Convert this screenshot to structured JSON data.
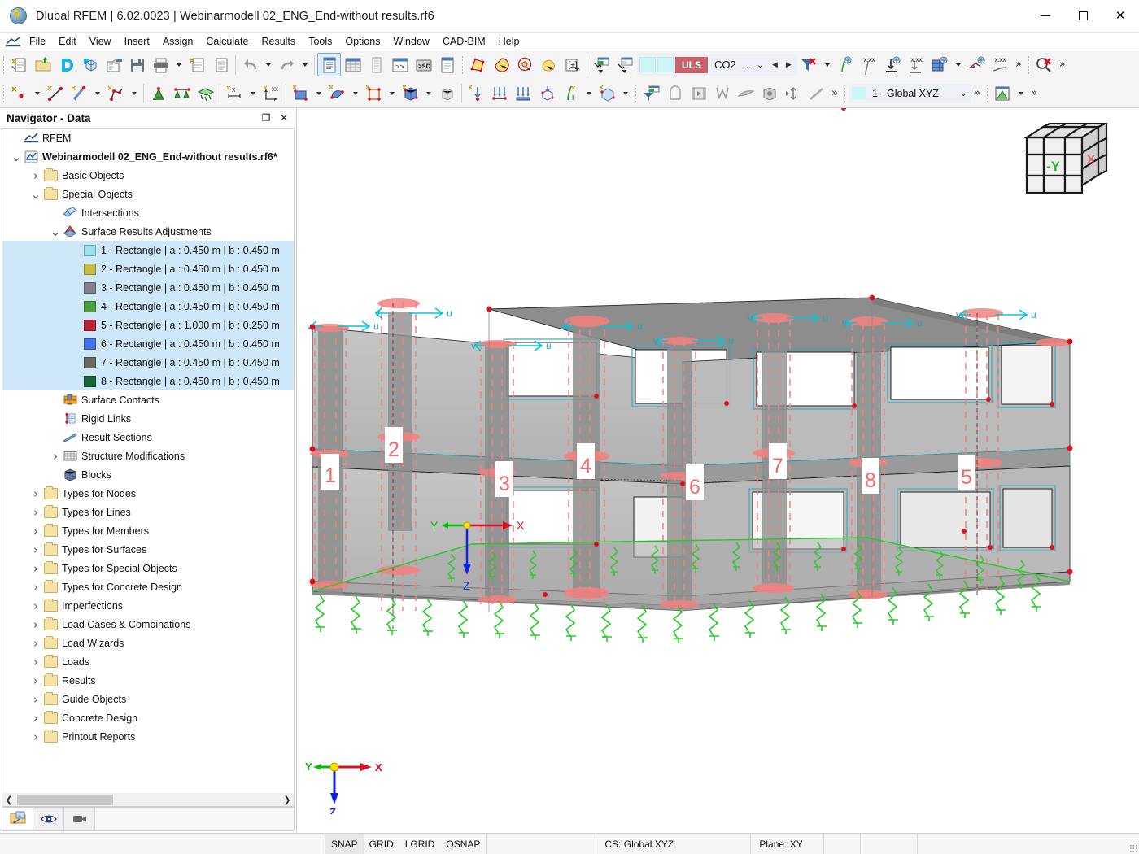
{
  "window": {
    "title": "Dlubal RFEM | 6.02.0023 | Webinarmodell 02_ENG_End-without results.rf6",
    "app_icon": "dlubal-globe-icon",
    "minimize_label": "Minimize",
    "maximize_label": "Maximize",
    "close_label": "Close"
  },
  "menubar": {
    "items": [
      {
        "label": "File"
      },
      {
        "label": "Edit"
      },
      {
        "label": "View"
      },
      {
        "label": "Insert"
      },
      {
        "label": "Assign"
      },
      {
        "label": "Calculate"
      },
      {
        "label": "Results"
      },
      {
        "label": "Tools"
      },
      {
        "label": "Options"
      },
      {
        "label": "Window"
      },
      {
        "label": "CAD-BIM"
      },
      {
        "label": "Help"
      }
    ]
  },
  "toolbar_loadcase": {
    "uls_label": "ULS",
    "co2_label": "CO2",
    "ellipsis_label": "...",
    "prev_label": "◀",
    "next_label": "▶"
  },
  "toolbar_cs": {
    "value": "1 - Global XYZ",
    "overflow_label": "»"
  },
  "navigator": {
    "title": "Navigator - Data",
    "undock_label": "❐",
    "close_label": "✕",
    "tabs": [
      {
        "name": "data-tab",
        "icon": "navigator-data-icon",
        "active": true
      },
      {
        "name": "display-tab",
        "icon": "eye-icon",
        "active": false
      },
      {
        "name": "views-tab",
        "icon": "video-camera-icon",
        "active": false
      }
    ],
    "tree": [
      {
        "label": "RFEM",
        "indent": 0,
        "icon": "rfem-icon",
        "twisty": "",
        "bold": false,
        "selected": false
      },
      {
        "label": "Webinarmodell 02_ENG_End-without results.rf6*",
        "indent": 0,
        "icon": "model-icon",
        "twisty": "expanded",
        "bold": true,
        "selected": false
      },
      {
        "label": "Basic Objects",
        "indent": 1,
        "icon": "folder",
        "twisty": "collapsed",
        "bold": false,
        "selected": false
      },
      {
        "label": "Special Objects",
        "indent": 1,
        "icon": "folder",
        "twisty": "expanded",
        "bold": false,
        "selected": false
      },
      {
        "label": "Intersections",
        "indent": 2,
        "icon": "intersections-icon",
        "twisty": "",
        "bold": false,
        "selected": false
      },
      {
        "label": "Surface Results Adjustments",
        "indent": 2,
        "icon": "surface-results-adjustments-icon",
        "twisty": "expanded",
        "bold": false,
        "selected": false
      },
      {
        "label": "1 - Rectangle | a : 0.450 m | b : 0.450 m",
        "indent": 3,
        "icon": "color-swatch",
        "color": "#9fe2ee",
        "twisty": "",
        "bold": false,
        "selected": true
      },
      {
        "label": "2 - Rectangle | a : 0.450 m | b : 0.450 m",
        "indent": 3,
        "icon": "color-swatch",
        "color": "#c4bd45",
        "twisty": "",
        "bold": false,
        "selected": true
      },
      {
        "label": "3 - Rectangle | a : 0.450 m | b : 0.450 m",
        "indent": 3,
        "icon": "color-swatch",
        "color": "#837f92",
        "twisty": "",
        "bold": false,
        "selected": true
      },
      {
        "label": "4 - Rectangle | a : 0.450 m | b : 0.450 m",
        "indent": 3,
        "icon": "color-swatch",
        "color": "#4a9e3c",
        "twisty": "",
        "bold": false,
        "selected": true
      },
      {
        "label": "5 - Rectangle | a : 1.000 m | b : 0.250 m",
        "indent": 3,
        "icon": "color-swatch",
        "color": "#bb2137",
        "twisty": "",
        "bold": false,
        "selected": true
      },
      {
        "label": "6 - Rectangle | a : 0.450 m | b : 0.450 m",
        "indent": 3,
        "icon": "color-swatch",
        "color": "#4a72e8",
        "twisty": "",
        "bold": false,
        "selected": true
      },
      {
        "label": "7 - Rectangle | a : 0.450 m | b : 0.450 m",
        "indent": 3,
        "icon": "color-swatch",
        "color": "#676a60",
        "twisty": "",
        "bold": false,
        "selected": true
      },
      {
        "label": "8 - Rectangle | a : 0.450 m | b : 0.450 m",
        "indent": 3,
        "icon": "color-swatch",
        "color": "#18663a",
        "twisty": "",
        "bold": false,
        "selected": true
      },
      {
        "label": "Surface Contacts",
        "indent": 2,
        "icon": "surface-contacts-icon",
        "twisty": "",
        "bold": false,
        "selected": false
      },
      {
        "label": "Rigid Links",
        "indent": 2,
        "icon": "rigid-links-icon",
        "twisty": "",
        "bold": false,
        "selected": false
      },
      {
        "label": "Result Sections",
        "indent": 2,
        "icon": "result-sections-icon",
        "twisty": "",
        "bold": false,
        "selected": false
      },
      {
        "label": "Structure Modifications",
        "indent": 2,
        "icon": "structure-modifications-icon",
        "twisty": "collapsed",
        "bold": false,
        "selected": false
      },
      {
        "label": "Blocks",
        "indent": 2,
        "icon": "blocks-icon",
        "twisty": "",
        "bold": false,
        "selected": false
      },
      {
        "label": "Types for Nodes",
        "indent": 1,
        "icon": "folder",
        "twisty": "collapsed",
        "bold": false,
        "selected": false
      },
      {
        "label": "Types for Lines",
        "indent": 1,
        "icon": "folder",
        "twisty": "collapsed",
        "bold": false,
        "selected": false
      },
      {
        "label": "Types for Members",
        "indent": 1,
        "icon": "folder",
        "twisty": "collapsed",
        "bold": false,
        "selected": false
      },
      {
        "label": "Types for Surfaces",
        "indent": 1,
        "icon": "folder",
        "twisty": "collapsed",
        "bold": false,
        "selected": false
      },
      {
        "label": "Types for Special Objects",
        "indent": 1,
        "icon": "folder",
        "twisty": "collapsed",
        "bold": false,
        "selected": false
      },
      {
        "label": "Types for Concrete Design",
        "indent": 1,
        "icon": "folder",
        "twisty": "collapsed",
        "bold": false,
        "selected": false
      },
      {
        "label": "Imperfections",
        "indent": 1,
        "icon": "folder",
        "twisty": "collapsed",
        "bold": false,
        "selected": false
      },
      {
        "label": "Load Cases & Combinations",
        "indent": 1,
        "icon": "folder",
        "twisty": "collapsed",
        "bold": false,
        "selected": false
      },
      {
        "label": "Load Wizards",
        "indent": 1,
        "icon": "folder",
        "twisty": "collapsed",
        "bold": false,
        "selected": false
      },
      {
        "label": "Loads",
        "indent": 1,
        "icon": "folder",
        "twisty": "collapsed",
        "bold": false,
        "selected": false
      },
      {
        "label": "Results",
        "indent": 1,
        "icon": "folder",
        "twisty": "collapsed",
        "bold": false,
        "selected": false
      },
      {
        "label": "Guide Objects",
        "indent": 1,
        "icon": "folder",
        "twisty": "collapsed",
        "bold": false,
        "selected": false
      },
      {
        "label": "Concrete Design",
        "indent": 1,
        "icon": "folder",
        "twisty": "collapsed",
        "bold": false,
        "selected": false
      },
      {
        "label": "Printout Reports",
        "indent": 1,
        "icon": "folder",
        "twisty": "collapsed",
        "bold": false,
        "selected": false
      }
    ]
  },
  "viewport": {
    "viewcube": {
      "front_axis_label": "-Y",
      "right_axis_label": "X"
    },
    "axes_gizmo": {
      "x_label": "X",
      "y_label": "Y",
      "z_label": "Z"
    },
    "model_labels": [
      "1",
      "2",
      "3",
      "4",
      "5",
      "6",
      "7",
      "8"
    ],
    "local_axis_labels": {
      "u": "u",
      "v": "v"
    },
    "colors": {
      "surface_fill": "#b4b4b4",
      "slab_fill": "#8e8e8e",
      "adjustment_marker": "#f08080",
      "local_axis_u": "#00c8d7",
      "local_axis_v": "#00c8d7",
      "support_spring": "#22cc22",
      "node": "#e01020",
      "axis_x": "#e01020",
      "axis_y": "#00c000",
      "axis_z": "#1020e0"
    }
  },
  "statusbar": {
    "snaps": [
      {
        "label": "SNAP",
        "active": true
      },
      {
        "label": "GRID",
        "active": false
      },
      {
        "label": "LGRID",
        "active": false
      },
      {
        "label": "OSNAP",
        "active": false
      }
    ],
    "cs": "CS: Global XYZ",
    "plane": "Plane: XY"
  }
}
